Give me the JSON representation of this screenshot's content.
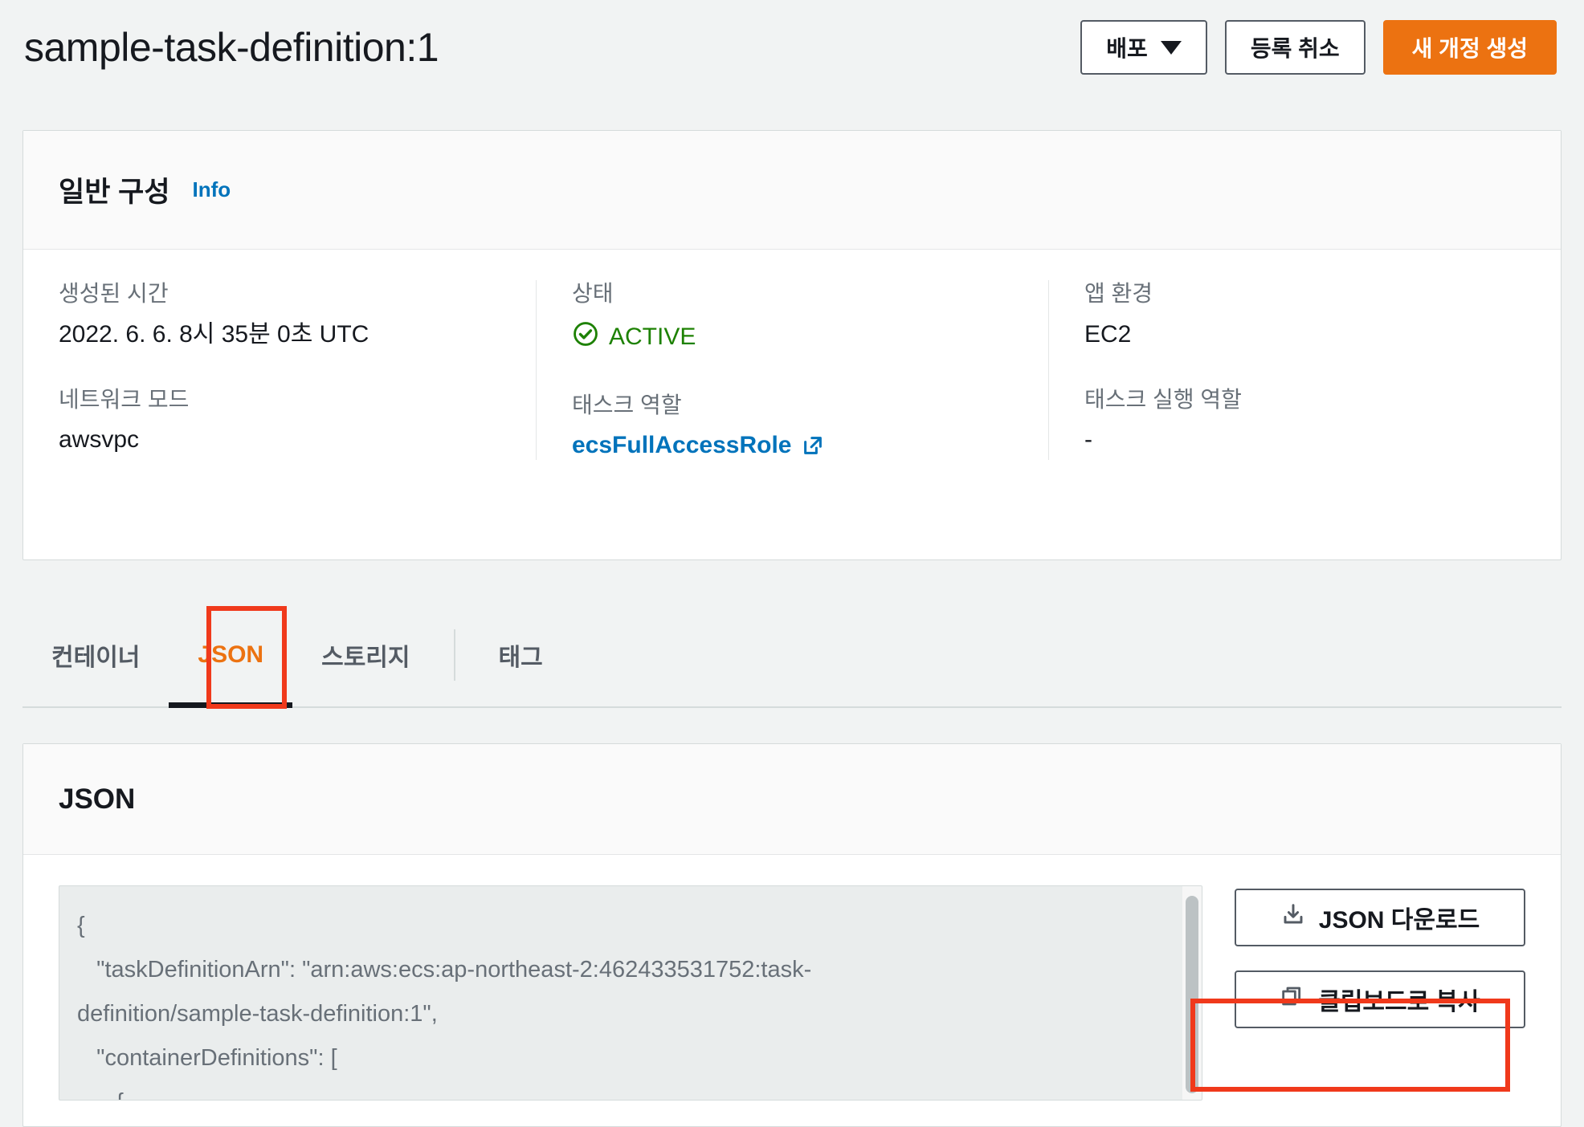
{
  "header": {
    "title": "sample-task-definition:1",
    "actions": {
      "deploy_label": "배포",
      "deregister_label": "등록 취소",
      "create_revision_label": "새 개정 생성"
    }
  },
  "general": {
    "section_title": "일반 구성",
    "info_label": "Info",
    "fields": {
      "created_at_label": "생성된 시간",
      "created_at_value": "2022. 6. 6. 8시 35분 0초 UTC",
      "status_label": "상태",
      "status_value": "ACTIVE",
      "app_env_label": "앱 환경",
      "app_env_value": "EC2",
      "network_mode_label": "네트워크 모드",
      "network_mode_value": "awsvpc",
      "task_role_label": "태스크 역할",
      "task_role_value": "ecsFullAccessRole",
      "task_exec_role_label": "태스크 실행 역할",
      "task_exec_role_value": "-"
    }
  },
  "tabs": [
    {
      "label": "컨테이너",
      "active": false
    },
    {
      "label": "JSON",
      "active": true
    },
    {
      "label": "스토리지",
      "active": false
    },
    {
      "label": "태그",
      "active": false
    }
  ],
  "json_panel": {
    "section_title": "JSON",
    "code_lines": [
      "{",
      "   \"taskDefinitionArn\": \"arn:aws:ecs:ap-northeast-2:462433531752:task-",
      "definition/sample-task-definition:1\",",
      "   \"containerDefinitions\": [",
      "      {"
    ],
    "download_label": "JSON 다운로드",
    "copy_label": "클립보드로 복사"
  },
  "colors": {
    "accent_orange": "#ec7211",
    "link_blue": "#0073bb",
    "status_green": "#1d8102",
    "annotation_red": "#f0391b",
    "page_background": "#f1f3f3"
  }
}
